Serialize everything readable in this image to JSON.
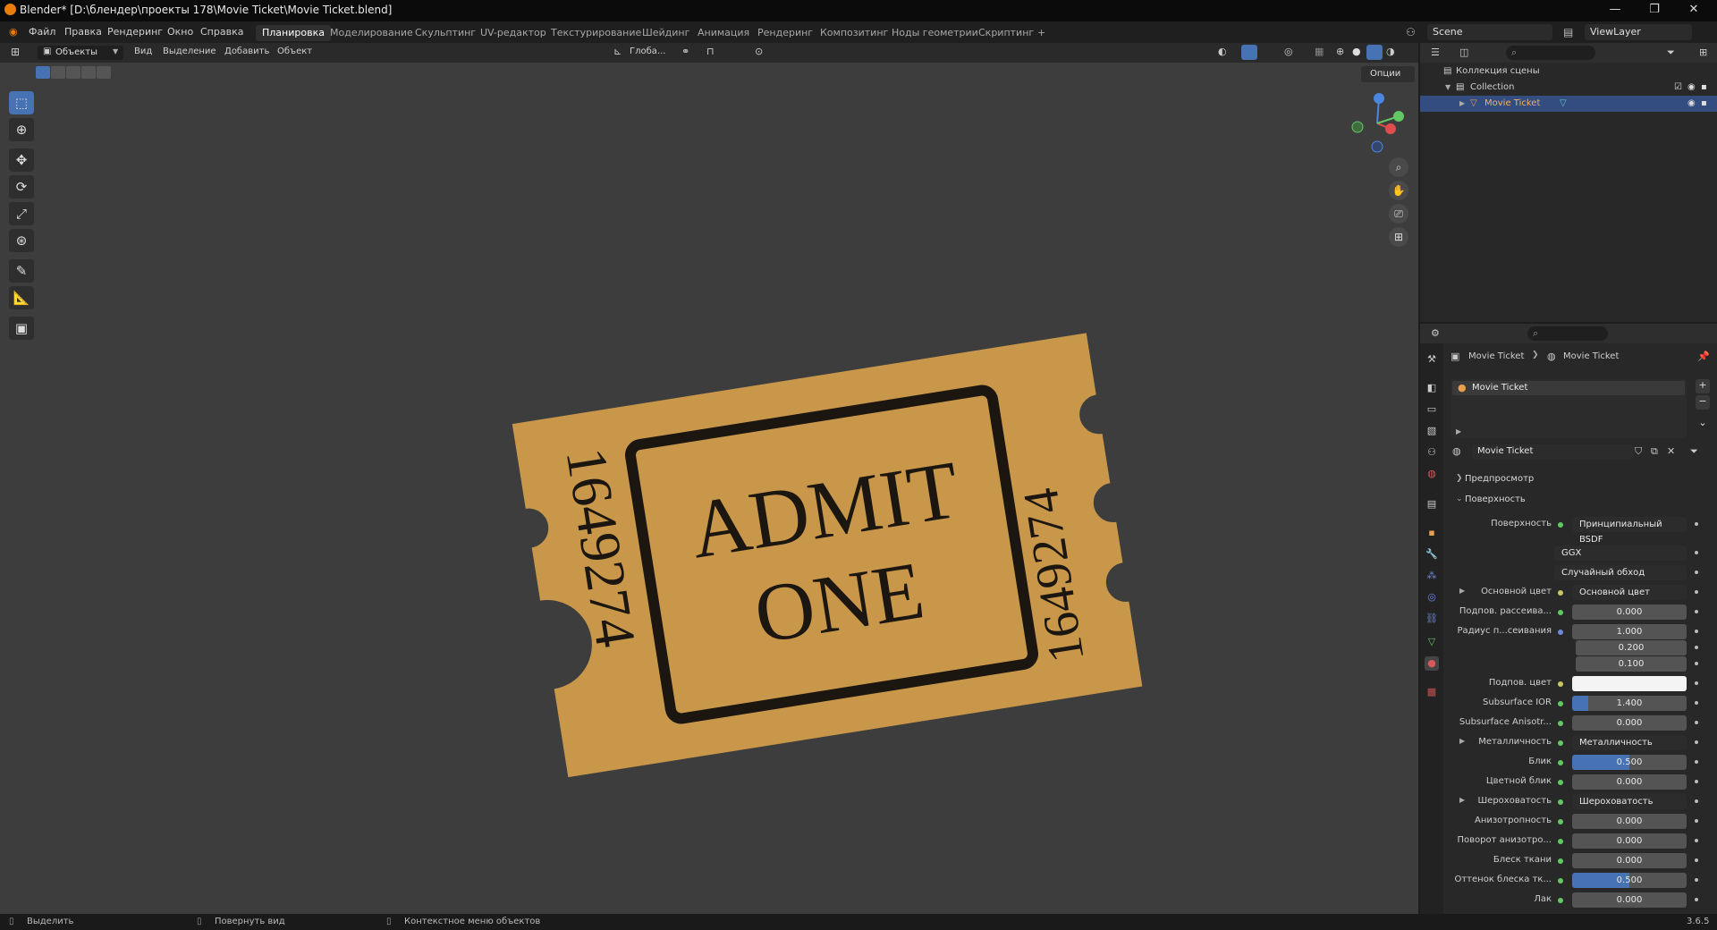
{
  "title": "Blender* [D:\\блендер\\проекты 178\\Movie Ticket\\Movie Ticket.blend]",
  "menu": [
    "Файл",
    "Правка",
    "Рендеринг",
    "Окно",
    "Справка"
  ],
  "workspaces": [
    "Планировка",
    "Моделирование",
    "Скульптинг",
    "UV-редактор",
    "Текстурирование",
    "Шейдинг",
    "Анимация",
    "Рендеринг",
    "Композитинг",
    "Ноды геометрии",
    "Скриптинг",
    "+"
  ],
  "scene": "Scene",
  "view_layer": "ViewLayer",
  "vp": {
    "mode": "Объекты",
    "menus": [
      "Вид",
      "Выделение",
      "Добавить",
      "Объект"
    ],
    "orient": "Глоба...",
    "options": "Опции"
  },
  "ticket": {
    "admit": "ADMIT",
    "one": "ONE",
    "number": "1649274",
    "color": "#c8974a"
  },
  "outliner": {
    "root": "Коллекция сцены",
    "collection": "Collection",
    "object": "Movie Ticket"
  },
  "props": {
    "breadcrumb_obj": "Movie Ticket",
    "breadcrumb_mat": "Movie Ticket",
    "slot": "Movie Ticket",
    "material": "Movie Ticket",
    "preview": "Предпросмотр",
    "surface_sec": "Поверхность",
    "rows": [
      {
        "label": "Поверхность",
        "value": "Принципиальный BSDF",
        "kind": "dark",
        "dot": "g"
      },
      {
        "label": "",
        "value": "GGX",
        "kind": "dark"
      },
      {
        "label": "",
        "value": "Случайный обход",
        "kind": "dark"
      },
      {
        "label": "Основной цвет",
        "value": "Основной цвет",
        "kind": "dark",
        "dot": "y",
        "exp": true
      },
      {
        "label": "Подпов. рассеива...",
        "value": "0.000",
        "dot": "g"
      },
      {
        "label": "Радиус п...сеивания",
        "value": "1.000",
        "dot": "b"
      },
      {
        "label": "",
        "value": "0.200"
      },
      {
        "label": "",
        "value": "0.100"
      },
      {
        "label": "Подпов. цвет",
        "value": "",
        "kind": "white",
        "dot": "y"
      },
      {
        "label": "Subsurface IOR",
        "value": "1.400",
        "kind": "ior",
        "dot": "g"
      },
      {
        "label": "Subsurface Anisotr...",
        "value": "0.000",
        "dot": "g"
      },
      {
        "label": "Металличность",
        "value": "Металличность",
        "kind": "dark",
        "dot": "g",
        "exp": true
      },
      {
        "label": "Блик",
        "value": "0.500",
        "kind": "blue",
        "dot": "g"
      },
      {
        "label": "Цветной блик",
        "value": "0.000",
        "dot": "g"
      },
      {
        "label": "Шероховатость",
        "value": "Шероховатость",
        "kind": "dark",
        "dot": "g",
        "exp": true
      },
      {
        "label": "Анизотропность",
        "value": "0.000",
        "dot": "g"
      },
      {
        "label": "Поворот анизотро...",
        "value": "0.000",
        "dot": "g"
      },
      {
        "label": "Блеск ткани",
        "value": "0.000",
        "dot": "g"
      },
      {
        "label": "Оттенок блеска тк...",
        "value": "0.500",
        "kind": "blue",
        "dot": "g"
      },
      {
        "label": "Лак",
        "value": "0.000",
        "dot": "g"
      }
    ]
  },
  "status": {
    "select": "Выделить",
    "rotate": "Повернуть вид",
    "context": "Контекстное меню объектов",
    "version": "3.6.5"
  }
}
